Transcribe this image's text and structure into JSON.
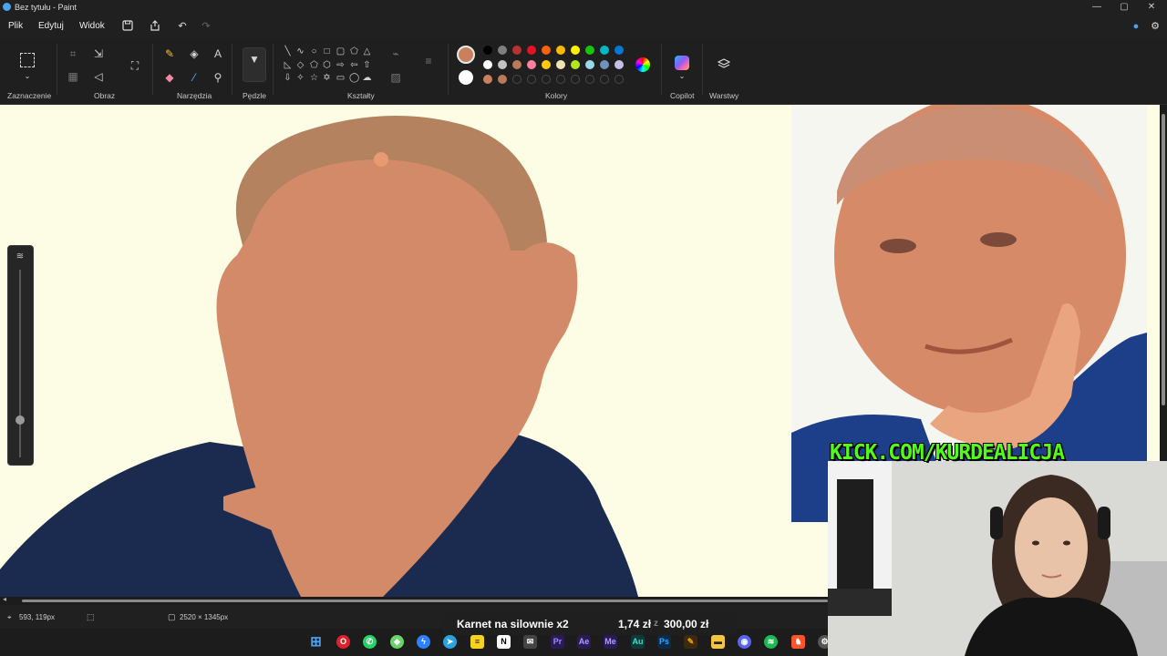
{
  "window": {
    "title": "Bez tytułu - Paint",
    "controls": {
      "minimize": "—",
      "maximize": "▢",
      "close": "✕"
    }
  },
  "menu": {
    "items": [
      "Plik",
      "Edytuj",
      "Widok"
    ],
    "toolbar_icons": [
      "save-icon",
      "share-icon",
      "undo-icon",
      "redo-icon"
    ]
  },
  "ribbon": {
    "groups": {
      "selection": "Zaznaczenie",
      "image": "Obraz",
      "tools": "Narzędzia",
      "brushes": "Pędzle",
      "shapes": "Kształty",
      "colors": "Kolory",
      "copilot": "Copilot",
      "layers": "Warstwy"
    },
    "tools": [
      "pencil-icon",
      "fill-icon",
      "text-icon",
      "eraser-icon",
      "color-picker-icon",
      "magnifier-icon"
    ],
    "shapes": [
      "line",
      "curve",
      "oval",
      "rectangle",
      "rounded-rectangle",
      "polygon",
      "triangle",
      "right-triangle",
      "diamond",
      "pentagon",
      "hexagon",
      "right-arrow",
      "left-arrow",
      "up-arrow",
      "down-arrow",
      "four-point-star",
      "five-point-star",
      "six-point-star",
      "callout-rect",
      "callout-oval",
      "callout-cloud"
    ],
    "colors": {
      "primary": "#c8805f",
      "secondary": "#ffffff",
      "palette_row1": [
        "#000000",
        "#7f7f7f",
        "#b83232",
        "#e81123",
        "#f7630c",
        "#ffb900",
        "#fff100",
        "#16c60c",
        "#00b7c3",
        "#0078d4",
        "#5c2d91",
        "#b146c2"
      ],
      "palette_row2": [
        "#ffffff",
        "#c3c3c3",
        "#b97a57",
        "#ff7f9f",
        "#ffc90e",
        "#efe4b0",
        "#b5e61d",
        "#99d9ea",
        "#7092be",
        "#c8bfe7"
      ],
      "palette_row3": [
        "#c8805f",
        "#b97a57"
      ]
    }
  },
  "statusbar": {
    "cursor_pos": "593, 119px",
    "canvas_size": "2520 × 1345px"
  },
  "overlay": {
    "item": "Karnet na silownie x2",
    "progress": "1,74 zł",
    "separator": "z",
    "goal": "300,00 zł"
  },
  "stream": {
    "kick_text": "KICK.COM/KURDEALICJA"
  },
  "taskbar": {
    "apps": [
      "windows-start-icon",
      "opera-icon",
      "whatsapp-icon",
      "vpn-icon",
      "messenger-icon",
      "telegram-icon",
      "notes-icon",
      "notion-icon",
      "mail-icon",
      "premiere-icon",
      "after-effects-icon",
      "media-encoder-icon",
      "audition-icon",
      "photoshop-icon",
      "paint-icon",
      "file-explorer-icon",
      "discord-icon",
      "spotify-icon",
      "brave-icon",
      "settings-icon"
    ]
  }
}
